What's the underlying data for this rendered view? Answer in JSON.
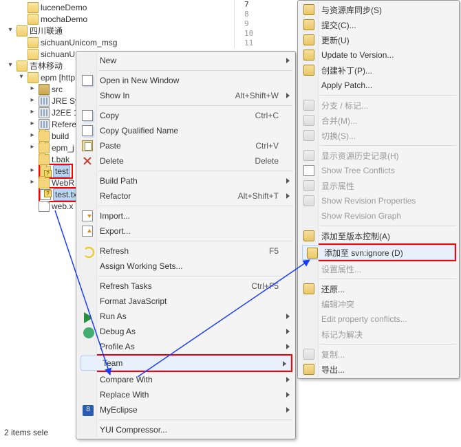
{
  "tree": {
    "nodes": [
      {
        "level": 1,
        "exp": "",
        "icon": "ic-folders",
        "label": "luceneDemo"
      },
      {
        "level": 1,
        "exp": "",
        "icon": "ic-folders",
        "label": "mochaDemo"
      },
      {
        "level": 0,
        "exp": "▾",
        "icon": "ic-prj",
        "label": "四川联通"
      },
      {
        "level": 1,
        "exp": "",
        "icon": "ic-folders",
        "label": "sichuanUnicom_msg"
      },
      {
        "level": 1,
        "exp": "",
        "icon": "ic-folders",
        "label": "sichuanU"
      },
      {
        "level": 0,
        "exp": "▾",
        "icon": "ic-prj",
        "label": "吉林移动"
      },
      {
        "level": 1,
        "exp": "▾",
        "icon": "ic-folders",
        "label": "epm [http"
      },
      {
        "level": 2,
        "exp": "▸",
        "icon": "ic-src",
        "label": "src"
      },
      {
        "level": 2,
        "exp": "▸",
        "icon": "ic-lib",
        "label": "JRE Sy"
      },
      {
        "level": 2,
        "exp": "▸",
        "icon": "ic-lib",
        "label": "J2EE 1"
      },
      {
        "level": 2,
        "exp": "▸",
        "icon": "ic-lib",
        "label": "Refere"
      },
      {
        "level": 2,
        "exp": "▸",
        "icon": "ic-folder",
        "label": "build"
      },
      {
        "level": 2,
        "exp": "▸",
        "icon": "ic-folder",
        "label": "epm_j"
      },
      {
        "level": 2,
        "exp": "",
        "icon": "ic-folder",
        "label": "t.bak"
      },
      {
        "level": 2,
        "exp": "▸",
        "icon": "ic-folder svnq",
        "label": "test",
        "hl": "sel",
        "box": true
      },
      {
        "level": 2,
        "exp": "▸",
        "icon": "ic-folder",
        "label": "WebR"
      },
      {
        "level": 2,
        "exp": "",
        "icon": "ic-file svnq",
        "label": "test.tx",
        "hl": "sel",
        "box": true
      },
      {
        "level": 2,
        "exp": "",
        "icon": "ic-file",
        "label": "web.x"
      }
    ]
  },
  "statusbar": "2 items sele",
  "codelines": [
    "7",
    "8",
    "9",
    "10",
    "11"
  ],
  "menu1": {
    "items": [
      {
        "label": "New",
        "sub": true
      },
      {
        "sep": true
      },
      {
        "label": "Open in New Window",
        "icon": "m-newwin"
      },
      {
        "label": "Show In",
        "accel": "Alt+Shift+W",
        "sub": true
      },
      {
        "sep": true
      },
      {
        "label": "Copy",
        "accel": "Ctrl+C",
        "icon": "m-copy"
      },
      {
        "label": "Copy Qualified Name",
        "icon": "m-copy"
      },
      {
        "label": "Paste",
        "accel": "Ctrl+V",
        "icon": "m-paste"
      },
      {
        "label": "Delete",
        "accel": "Delete",
        "icon": "m-del"
      },
      {
        "sep": true
      },
      {
        "label": "Build Path",
        "sub": true
      },
      {
        "label": "Refactor",
        "accel": "Alt+Shift+T",
        "sub": true
      },
      {
        "sep": true
      },
      {
        "label": "Import...",
        "icon": "m-import"
      },
      {
        "label": "Export...",
        "icon": "m-export"
      },
      {
        "sep": true
      },
      {
        "label": "Refresh",
        "accel": "F5",
        "icon": "m-refresh"
      },
      {
        "label": "Assign Working Sets..."
      },
      {
        "sep": true
      },
      {
        "label": "Refresh Tasks",
        "accel": "Ctrl+F5"
      },
      {
        "label": "Format JavaScript"
      },
      {
        "label": "Run As",
        "sub": true,
        "icon": "m-run"
      },
      {
        "label": "Debug As",
        "sub": true,
        "icon": "m-debug"
      },
      {
        "label": "Profile As",
        "sub": true
      },
      {
        "label": "Team",
        "sub": true,
        "hov": true,
        "box": true
      },
      {
        "label": "Compare With",
        "sub": true
      },
      {
        "label": "Replace With",
        "sub": true
      },
      {
        "label": "MyEclipse",
        "sub": true,
        "icon": "m-myecl",
        "iconText": "8"
      },
      {
        "sep": true
      },
      {
        "label": "YUI Compressor..."
      }
    ]
  },
  "menu2": {
    "items": [
      {
        "label": "与资源库同步(S)",
        "icon": "m-svn"
      },
      {
        "label": "提交(C)...",
        "icon": "m-svn"
      },
      {
        "label": "更新(U)",
        "icon": "m-svn"
      },
      {
        "label": "Update to Version...",
        "icon": "m-svn"
      },
      {
        "label": "创建补丁(P)...",
        "icon": "m-svn"
      },
      {
        "label": "Apply Patch..."
      },
      {
        "sep": true
      },
      {
        "label": "分支 / 标记...",
        "icon": "m-svn-dis",
        "dis": true
      },
      {
        "label": "合并(M)...",
        "icon": "m-svn-dis",
        "dis": true
      },
      {
        "label": "切换(S)...",
        "icon": "m-svn-dis",
        "dis": true
      },
      {
        "sep": true
      },
      {
        "label": "显示资源历史记录(H)",
        "icon": "m-svn-dis",
        "dis": true
      },
      {
        "label": "Show Tree Conflicts",
        "icon": "m-tree",
        "dis": true
      },
      {
        "label": "显示属性",
        "icon": "m-svn-dis",
        "dis": true
      },
      {
        "label": "Show Revision Properties",
        "icon": "m-svn-dis",
        "dis": true
      },
      {
        "label": "Show Revision Graph",
        "dis": true
      },
      {
        "sep": true
      },
      {
        "label": "添加至版本控制(A)",
        "icon": "m-svn"
      },
      {
        "label": "添加至 svn:ignore (D)",
        "icon": "m-svn",
        "hov": true,
        "box": true
      },
      {
        "label": "设置属性...",
        "dis": true
      },
      {
        "sep": true
      },
      {
        "label": "还原...",
        "icon": "m-svn"
      },
      {
        "label": "编辑冲突",
        "dis": true
      },
      {
        "label": "Edit property conflicts...",
        "dis": true
      },
      {
        "label": "标记为解决",
        "dis": true
      },
      {
        "sep": true
      },
      {
        "label": "复制...",
        "icon": "m-svn-dis",
        "dis": true
      },
      {
        "label": "导出...",
        "icon": "m-svn"
      }
    ]
  }
}
